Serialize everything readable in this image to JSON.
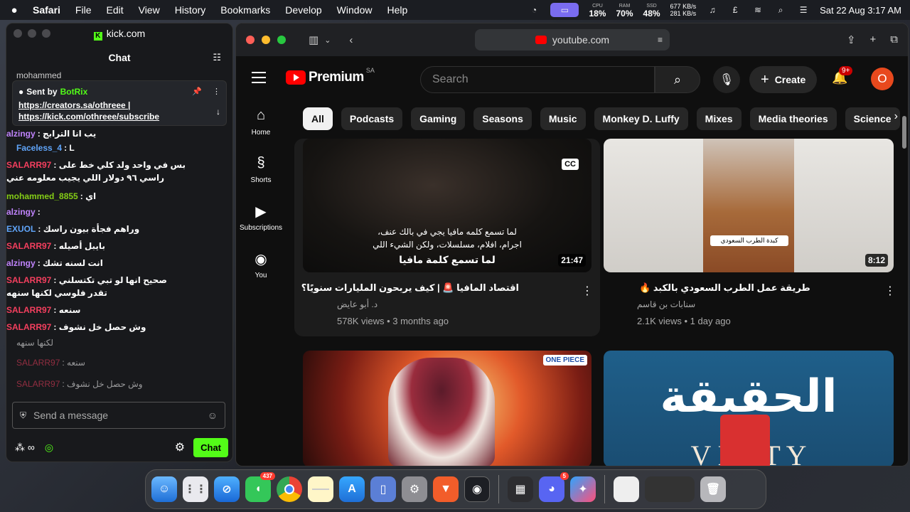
{
  "menubar": {
    "app": "Safari",
    "items": [
      "File",
      "Edit",
      "View",
      "History",
      "Bookmarks",
      "Develop",
      "Window",
      "Help"
    ],
    "cpu_label": "CPU",
    "cpu": "18%",
    "ram_label": "RAM",
    "ram": "70%",
    "ssd_label": "SSD",
    "ssd": "48%",
    "net_up": "677 KB/s",
    "net_down": "281 KB/s",
    "clock": "Sat 22 Aug  3:17 AM"
  },
  "kick": {
    "url": "kick.com",
    "chat_title": "Chat",
    "top_user": "mohammed",
    "pinned": {
      "sent_by": "Sent by",
      "bot": "BotRix",
      "link1": "https://creators.sa/othreee |",
      "link2": "https://kick.com/othreee/subscribe"
    },
    "lines": [
      {
        "user": "alzingy",
        "msg": ": يب انا الترابج",
        "color": "#c084fc"
      },
      {
        "user": "Faceless_4",
        "msg": ": L",
        "color": "#60a5fa"
      },
      {
        "user": "SALARR97",
        "msg": ": بس في واحد ولد كلي خط على",
        "color": "#f43f5e"
      },
      {
        "user": "",
        "msg": "راسي ٩٦ دولار اللي يجيب معلومه عني",
        "color": "#fff"
      },
      {
        "user": "mohammed_8855",
        "msg": ": اي",
        "color": "#84cc16"
      },
      {
        "user": "alzingy",
        "msg": ":",
        "color": "#c084fc"
      },
      {
        "user": "EXUOL",
        "msg": ": وراهم فجأة بيون راسك",
        "color": "#60a5fa"
      },
      {
        "user": "SALARR97",
        "msg": ": بايبل أصيله",
        "color": "#f43f5e"
      },
      {
        "user": "alzingy",
        "msg": ": انت لسنه تشك",
        "color": "#c084fc"
      },
      {
        "user": "SALARR97",
        "msg": ": صحيح انها لو تبي تكتسلني",
        "color": "#f43f5e"
      },
      {
        "user": "",
        "msg": "تقدر فلوسي لكنها سنهه",
        "color": "#fff"
      },
      {
        "user": "SALARR97",
        "msg": ": سنعه",
        "color": "#f43f5e"
      },
      {
        "user": "SALARR97",
        "msg": ": وش حصل خل نشوف",
        "color": "#f43f5e"
      },
      {
        "user": "",
        "msg": "لكنها سنهه",
        "color": "#fff"
      },
      {
        "user": "SALARR97",
        "msg": ": سنعه",
        "color": "#f43f5e"
      },
      {
        "user": "SALARR97",
        "msg": ": وش حصل خل نشوف",
        "color": "#f43f5e"
      }
    ],
    "send_placeholder": "Send a message",
    "chat_button": "Chat"
  },
  "safari": {
    "url": "youtube.com"
  },
  "youtube": {
    "brand": "Premium",
    "country": "SA",
    "search_placeholder": "Search",
    "create": "Create",
    "notif_badge": "9+",
    "avatar_letter": "O",
    "chips": [
      "All",
      "Podcasts",
      "Gaming",
      "Seasons",
      "Music",
      "Monkey D. Luffy",
      "Mixes",
      "Media theories",
      "Science"
    ],
    "sidebar": [
      {
        "label": "Home",
        "icon": "⌂"
      },
      {
        "label": "Shorts",
        "icon": "§"
      },
      {
        "label": "Subscriptions",
        "icon": "▶"
      },
      {
        "label": "You",
        "icon": "◉"
      }
    ],
    "videos": [
      {
        "title": "اقتصاد المافيا 🚨 | كيف يربحون المليارات سنويًا؟",
        "channel": "د. أبو عايض",
        "meta": "578K views • 3 months ago",
        "duration": "21:47",
        "overlay1": "لما تسمع كلمه مافيا يجي في بالك عنف،",
        "overlay2": "اجرام، افلام، مسلسلات، ولكن الشيء اللي",
        "overlay3": "لما تسمع كلمة مافيا",
        "cc": "CC"
      },
      {
        "title": "طريقة عمل الطرب السعودي بالكبد 🔥",
        "channel": "سنابات بن قاسم",
        "meta": "2.1K views • 1 day ago",
        "duration": "8:12",
        "overlay1": "كبدة الطرب السعودي"
      },
      {
        "overlay1": "ONE PIECE"
      },
      {
        "overlay1": "الحقيقة",
        "overlay2": "V E    T Y"
      }
    ]
  },
  "dock": {
    "messages_badge": "437",
    "discord_badge": "5"
  }
}
